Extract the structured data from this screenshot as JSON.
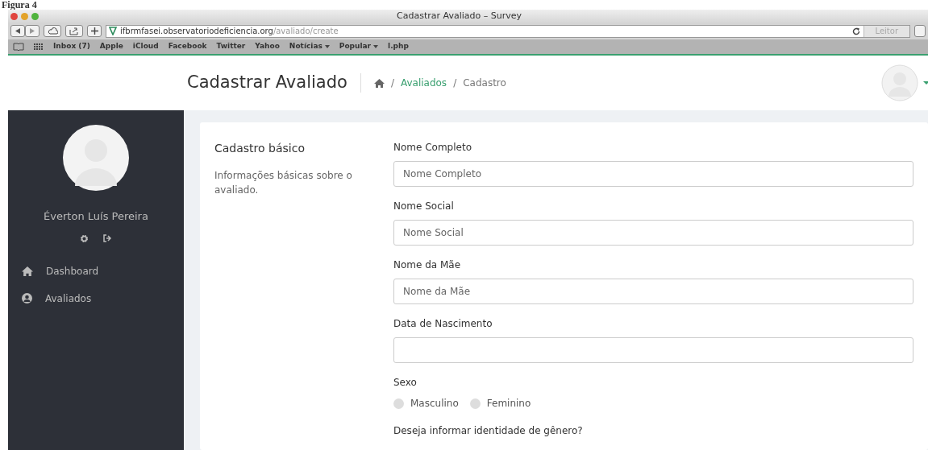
{
  "caption": "Figura 4",
  "browser": {
    "title": "Cadastrar Avaliado – Survey",
    "url_host": "ifbrmfasei.observatoriodeficiencia.org",
    "url_path": "/avaliado/create",
    "reader_button": "Leitor",
    "bookmarks": [
      {
        "label": "Inbox (7)",
        "dropdown": false
      },
      {
        "label": "Apple",
        "dropdown": false
      },
      {
        "label": "iCloud",
        "dropdown": false
      },
      {
        "label": "Facebook",
        "dropdown": false
      },
      {
        "label": "Twitter",
        "dropdown": false
      },
      {
        "label": "Yahoo",
        "dropdown": false
      },
      {
        "label": "Notícias",
        "dropdown": true
      },
      {
        "label": "Popular",
        "dropdown": true
      },
      {
        "label": "l.php",
        "dropdown": false
      }
    ]
  },
  "header": {
    "title": "Cadastrar Avaliado",
    "breadcrumb": [
      {
        "separator": "/",
        "label": "Avaliados",
        "link": true
      },
      {
        "separator": "/",
        "label": "Cadastro",
        "link": false
      }
    ]
  },
  "sidebar": {
    "user_name": "Éverton Luís Pereira",
    "menu": [
      {
        "label": "Dashboard",
        "kind": "home"
      },
      {
        "label": "Avaliados",
        "kind": "user"
      }
    ]
  },
  "section": {
    "title": "Cadastro básico",
    "description": "Informações básicas sobre o avaliado."
  },
  "fields": [
    {
      "kind": "text",
      "label": "Nome Completo",
      "placeholder": "Nome Completo"
    },
    {
      "kind": "text",
      "label": "Nome Social",
      "placeholder": "Nome Social"
    },
    {
      "kind": "text",
      "label": "Nome da Mãe",
      "placeholder": "Nome da Mãe"
    },
    {
      "kind": "text",
      "label": "Data de Nascimento"
    },
    {
      "kind": "radio",
      "label": "Sexo",
      "options": [
        {
          "label": "Masculino",
          "selected": false
        },
        {
          "label": "Feminino",
          "selected": false
        }
      ]
    },
    {
      "kind": "label",
      "label": "Deseja informar identidade de gênero?"
    }
  ]
}
